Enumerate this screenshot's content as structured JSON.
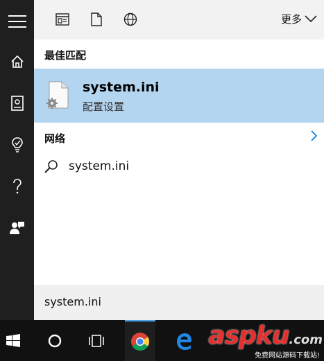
{
  "topbar": {
    "more_label": "更多"
  },
  "sections": {
    "best_match": "最佳匹配",
    "network": "网络"
  },
  "best_match_item": {
    "title": "system.ini",
    "subtitle": "配置设置"
  },
  "web_result": {
    "text": "system.ini"
  },
  "search": {
    "query": "system.ini"
  },
  "watermark": {
    "main": "aspku",
    "suffix": ".com",
    "sub": "免费网站源码下载站!"
  },
  "icons": {
    "rail": [
      "hamburger-icon",
      "home-icon",
      "notebook-icon",
      "lightbulb-icon",
      "help-icon",
      "feedback-icon"
    ],
    "top": [
      "apps-icon",
      "document-icon",
      "web-globe-icon"
    ],
    "taskbar": [
      "windows-start-icon",
      "cortana-circle-icon",
      "task-view-icon",
      "chrome-icon",
      "edge-icon"
    ]
  },
  "colors": {
    "rail": "#1f1f1f",
    "selected": "#b4d5f0",
    "taskbar": "#111111",
    "accent": "#0078d7"
  }
}
